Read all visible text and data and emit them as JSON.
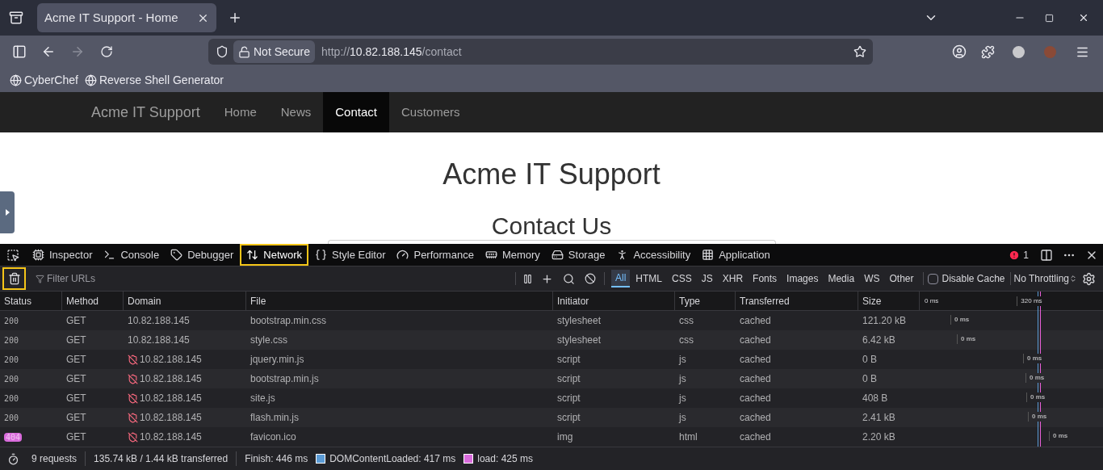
{
  "browser": {
    "tabs": [
      {
        "title": "Acme IT Support - Home",
        "selected": true
      }
    ],
    "address": {
      "security": "Not Secure",
      "url_prefix": "http://",
      "url_host": "10.82.188.145",
      "url_path": "/contact"
    },
    "bookmarks": [
      "CyberChef",
      "Reverse Shell Generator"
    ]
  },
  "site": {
    "brand": "Acme IT Support",
    "nav": [
      {
        "label": "Home",
        "selected": false
      },
      {
        "label": "News",
        "selected": false
      },
      {
        "label": "Contact",
        "selected": true
      },
      {
        "label": "Customers",
        "selected": false
      }
    ],
    "heading": "Acme IT Support",
    "subheading": "Contact Us"
  },
  "devtools": {
    "tabs": [
      {
        "label": "Inspector",
        "selected": false
      },
      {
        "label": "Console",
        "selected": false
      },
      {
        "label": "Debugger",
        "selected": false
      },
      {
        "label": "Network",
        "selected": true
      },
      {
        "label": "Style Editor",
        "selected": false
      },
      {
        "label": "Performance",
        "selected": false
      },
      {
        "label": "Memory",
        "selected": false
      },
      {
        "label": "Storage",
        "selected": false
      },
      {
        "label": "Accessibility",
        "selected": false
      },
      {
        "label": "Application",
        "selected": false
      }
    ],
    "error_count": "1",
    "filter_placeholder": "Filter URLs",
    "type_filters": [
      {
        "label": "All",
        "selected": true
      },
      {
        "label": "HTML",
        "selected": false
      },
      {
        "label": "CSS",
        "selected": false
      },
      {
        "label": "JS",
        "selected": false
      },
      {
        "label": "XHR",
        "selected": false
      },
      {
        "label": "Fonts",
        "selected": false
      },
      {
        "label": "Images",
        "selected": false
      },
      {
        "label": "Media",
        "selected": false
      },
      {
        "label": "WS",
        "selected": false
      },
      {
        "label": "Other",
        "selected": false
      }
    ],
    "disable_cache": {
      "label": "Disable Cache",
      "checked": false
    },
    "throttling": "No Throttling",
    "columns": [
      "Status",
      "Method",
      "Domain",
      "File",
      "Initiator",
      "Type",
      "Transferred",
      "Size"
    ],
    "waterfall_ticks": [
      "0 ms",
      "320 ms"
    ],
    "rows": [
      {
        "status": "200",
        "error": false,
        "method": "GET",
        "domain": "10.82.188.145",
        "insecure": false,
        "file": "bootstrap.min.css",
        "initiator": "stylesheet",
        "type": "css",
        "transferred": "cached",
        "size": "121.20 kB",
        "timing": "0 ms"
      },
      {
        "status": "200",
        "error": false,
        "method": "GET",
        "domain": "10.82.188.145",
        "insecure": false,
        "file": "style.css",
        "initiator": "stylesheet",
        "type": "css",
        "transferred": "cached",
        "size": "6.42 kB",
        "timing": "0 ms"
      },
      {
        "status": "200",
        "error": false,
        "method": "GET",
        "domain": "10.82.188.145",
        "insecure": true,
        "file": "jquery.min.js",
        "initiator": "script",
        "type": "js",
        "transferred": "cached",
        "size": "0 B",
        "timing": "0 ms"
      },
      {
        "status": "200",
        "error": false,
        "method": "GET",
        "domain": "10.82.188.145",
        "insecure": true,
        "file": "bootstrap.min.js",
        "initiator": "script",
        "type": "js",
        "transferred": "cached",
        "size": "0 B",
        "timing": "0 ms"
      },
      {
        "status": "200",
        "error": false,
        "method": "GET",
        "domain": "10.82.188.145",
        "insecure": true,
        "file": "site.js",
        "initiator": "script",
        "type": "js",
        "transferred": "cached",
        "size": "408 B",
        "timing": "0 ms"
      },
      {
        "status": "200",
        "error": false,
        "method": "GET",
        "domain": "10.82.188.145",
        "insecure": true,
        "file": "flash.min.js",
        "initiator": "script",
        "type": "js",
        "transferred": "cached",
        "size": "2.41 kB",
        "timing": "0 ms"
      },
      {
        "status": "404",
        "error": true,
        "method": "GET",
        "domain": "10.82.188.145",
        "insecure": true,
        "file": "favicon.ico",
        "initiator": "img",
        "type": "html",
        "transferred": "cached",
        "size": "2.20 kB",
        "timing": "0 ms"
      }
    ],
    "summary": {
      "requests": "9 requests",
      "transferred": "135.74 kB / 1.44 kB transferred",
      "finish": "Finish: 446 ms",
      "dom_content_loaded": "DOMContentLoaded: 417 ms",
      "load": "load: 425 ms"
    }
  }
}
